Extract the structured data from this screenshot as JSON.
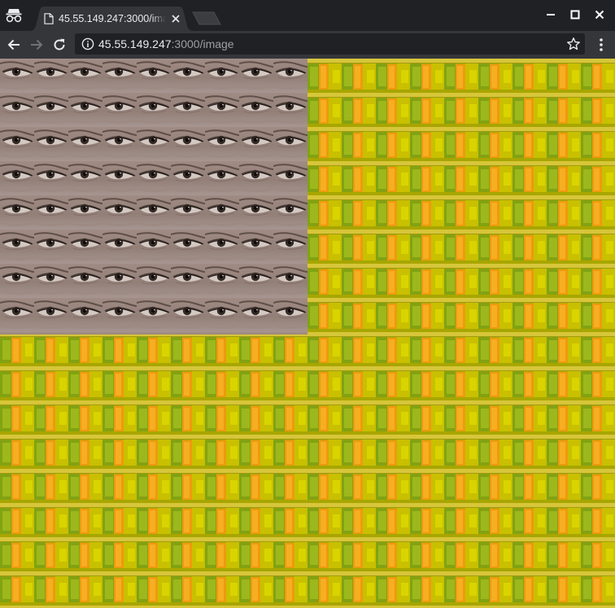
{
  "tab": {
    "title": "45.55.149.247:3000/image",
    "favicon": "document-icon"
  },
  "address_bar": {
    "host": "45.55.149.247",
    "path": ":3000/image"
  },
  "icons": {
    "incognito": "incognito-icon",
    "close_tab": "close-icon",
    "new_tab": "new-tab-icon",
    "minimize": "minimize-icon",
    "maximize": "maximize-icon",
    "close_window": "close-icon",
    "back": "arrow-left-icon",
    "forward": "arrow-right-icon",
    "reload": "reload-icon",
    "site_info": "info-icon",
    "bookmark": "star-icon",
    "menu": "kebab-menu-icon"
  },
  "page": {
    "content": "tiled image"
  },
  "colors": {
    "titlebar": "#202124",
    "toolbar": "#35363a",
    "omnibox": "#202124",
    "text_primary": "#e8eaed",
    "text_secondary": "#9aa0a6"
  }
}
